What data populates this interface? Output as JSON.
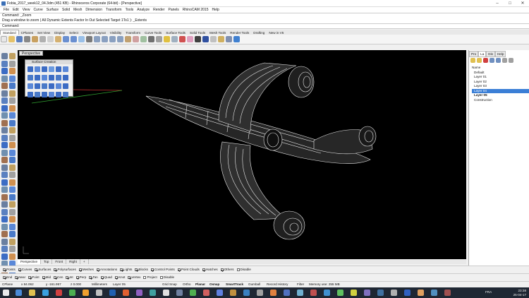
{
  "titlebar": {
    "title": "Fobia_2017_week12_04.3dm (451 KB) - Rhinoceros Corporate (64-bit) - [Perspective]",
    "min": "–",
    "max": "□",
    "close": "✕"
  },
  "menu": [
    "File",
    "Edit",
    "View",
    "Curve",
    "Surface",
    "Solid",
    "Mesh",
    "Dimension",
    "Transform",
    "Tools",
    "Analyze",
    "Render",
    "Panels",
    "RhinoCAM 2015",
    "Help"
  ],
  "command_history": [
    "Command: _Zoom",
    "Drag a window to zoom ( All  Dynamic  Extents  Factor  In  Out  Selected  Target  1To1 ): _Extents"
  ],
  "command_prompt": "Command:",
  "toolbar_tabs": [
    "Standard",
    "CPlanes",
    "Set View",
    "Display",
    "Select",
    "Viewport Layout",
    "Visibility",
    "Transform",
    "Curve Tools",
    "Surface Tools",
    "Solid Tools",
    "Mesh Tools",
    "Render Tools",
    "Drafting",
    "New in V5"
  ],
  "active_toolbar_tab": "Standard",
  "viewport_label": "Perspective",
  "surface_panel_title": "Surface Creation",
  "right_tabs": [
    "Pro",
    "La",
    "Dis",
    "Help"
  ],
  "layer_header": "Name",
  "layers": [
    {
      "name": "Default",
      "state": "normal"
    },
    {
      "name": "Layer 01",
      "state": "normal"
    },
    {
      "name": "Layer 02",
      "state": "normal"
    },
    {
      "name": "Layer 03",
      "state": "normal"
    },
    {
      "name": "Layer 04",
      "state": "selected"
    },
    {
      "name": "Layer 05",
      "state": "current"
    },
    {
      "name": "Construction",
      "state": "normal"
    }
  ],
  "viewport_tabs": [
    "Perspective",
    "Top",
    "Front",
    "Right",
    "+"
  ],
  "osnap_filters": [
    {
      "label": "Points",
      "checked": true
    },
    {
      "label": "Curves",
      "checked": true
    },
    {
      "label": "Surfaces",
      "checked": true
    },
    {
      "label": "Polysurfaces",
      "checked": true
    },
    {
      "label": "Meshes",
      "checked": true
    },
    {
      "label": "Annotations",
      "checked": true
    },
    {
      "label": "Lights",
      "checked": true
    },
    {
      "label": "Blocks",
      "checked": true
    },
    {
      "label": "Control Points",
      "checked": true
    },
    {
      "label": "Point Clouds",
      "checked": true
    },
    {
      "label": "Hatches",
      "checked": true
    },
    {
      "label": "Others",
      "checked": true
    },
    {
      "label": "Disable",
      "checked": false
    }
  ],
  "osnaps": [
    {
      "label": "End",
      "checked": true
    },
    {
      "label": "Near",
      "checked": true
    },
    {
      "label": "Point",
      "checked": true
    },
    {
      "label": "Mid",
      "checked": true
    },
    {
      "label": "Cen",
      "checked": true
    },
    {
      "label": "Int",
      "checked": true
    },
    {
      "label": "Perp",
      "checked": true
    },
    {
      "label": "Tan",
      "checked": true
    },
    {
      "label": "Quad",
      "checked": true
    },
    {
      "label": "Knot",
      "checked": true
    },
    {
      "label": "Vertex",
      "checked": true
    },
    {
      "label": "Project",
      "checked": false
    },
    {
      "label": "Disable",
      "checked": false
    }
  ],
  "status": {
    "cplane": "CPlane",
    "x": "x 84.062",
    "y": "y -161.957",
    "z": "z 0.000",
    "units": "Millimeters",
    "layer": "Layer 05",
    "toggles": [
      "Grid Snap",
      "Ortho",
      "Planar",
      "Osnap",
      "SmartTrack",
      "Gumball",
      "Record History",
      "Filter"
    ],
    "memory": "Memory use: 255 MB"
  },
  "clock": {
    "time": "23:38",
    "date": "25-04-17",
    "lang": "FRA"
  },
  "colors": {
    "viewport_bg": "#000000",
    "selection": "#3b7fd6",
    "taskbar": "#1f2733",
    "wire": "#ffffff"
  }
}
